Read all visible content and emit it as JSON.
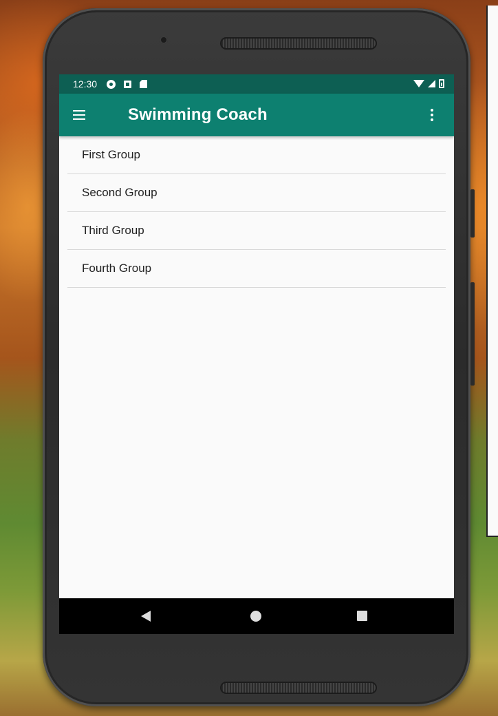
{
  "status_bar": {
    "time": "12:30",
    "left_icons": [
      "settings-icon",
      "app-notification-icon",
      "sd-card-icon"
    ],
    "right_icons": [
      "wifi-icon",
      "signal-icon",
      "battery-icon"
    ]
  },
  "app_bar": {
    "title": "Swimming Coach",
    "color": "#0d8070",
    "status_color": "#0d5f53",
    "nav_icon": "hamburger-menu-icon",
    "overflow_icon": "more-vert-icon"
  },
  "groups": [
    {
      "label": "First Group"
    },
    {
      "label": "Second Group"
    },
    {
      "label": "Third Group"
    },
    {
      "label": "Fourth Group"
    }
  ],
  "nav_bar": {
    "buttons": [
      "back-icon",
      "home-icon",
      "recents-icon"
    ]
  }
}
